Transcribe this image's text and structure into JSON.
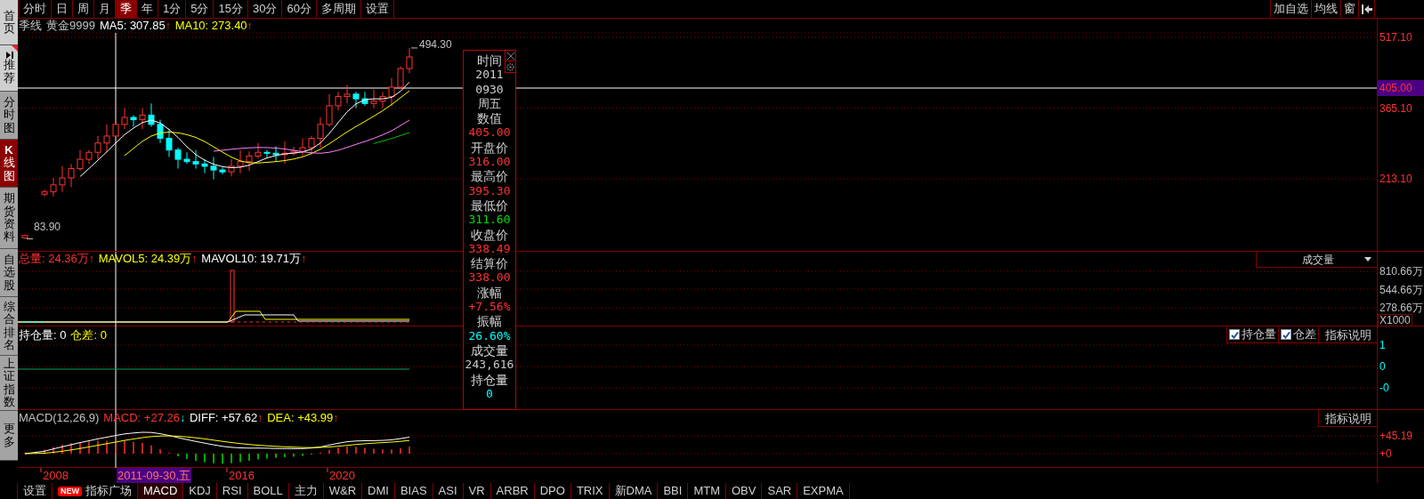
{
  "sidebar": {
    "items": [
      {
        "label": "首页",
        "kind": "light",
        "selected": false
      },
      {
        "label": "推荐",
        "kind": "recommend",
        "selected": false
      },
      {
        "label": "分时图",
        "kind": "page",
        "selected": false
      },
      {
        "label": "**K**线图",
        "kind": "page",
        "selected": true
      },
      {
        "label": "期货资料",
        "kind": "page",
        "selected": false
      },
      {
        "label": "自选股",
        "kind": "page",
        "selected": false
      },
      {
        "label": "综合排名",
        "kind": "page",
        "selected": false
      },
      {
        "label": "上证指数",
        "kind": "page",
        "selected": false
      },
      {
        "label": "更多",
        "kind": "page",
        "selected": false
      }
    ]
  },
  "toolbar": {
    "periods": [
      {
        "label": "分时",
        "selected": false
      },
      {
        "label": "日",
        "selected": false
      },
      {
        "label": "周",
        "selected": false
      },
      {
        "label": "月",
        "selected": false
      },
      {
        "label": "季",
        "selected": true
      },
      {
        "label": "年",
        "selected": false
      },
      {
        "label": "1分",
        "selected": false
      },
      {
        "label": "5分",
        "selected": false
      },
      {
        "label": "15分",
        "selected": false
      },
      {
        "label": "30分",
        "selected": false
      },
      {
        "label": "60分",
        "selected": false
      },
      {
        "label": "多周期",
        "selected": false
      },
      {
        "label": "设置",
        "selected": false
      }
    ],
    "actions": [
      "加自选",
      "均线",
      "窗"
    ]
  },
  "price_pane": {
    "legend": [
      {
        "text": "季线",
        "color": "#c0c0c0"
      },
      {
        "text": "黄金9999",
        "color": "#c0c0c0"
      },
      {
        "text": "MA5: 307.85",
        "color": "#ffffff",
        "arrow": "↑",
        "rising": true
      },
      {
        "text": "MA10: 273.40",
        "color": "#ffff00",
        "arrow": "↑",
        "rising": true
      }
    ],
    "high_marker": "494.30",
    "low_marker": "83.90",
    "axis_ticks": [
      "517.10",
      "365.10",
      "213.10"
    ],
    "crosshair_value": "405.00"
  },
  "volume_pane": {
    "legend": [
      {
        "text": "总量: 24.36万",
        "color": "#ff3232",
        "arrow": "↑",
        "rising": true
      },
      {
        "text": "MAVOL5: 24.39万",
        "color": "#ffff00",
        "arrow": "↑",
        "rising": true
      },
      {
        "text": "MAVOL10: 19.71万",
        "color": "#ffffff",
        "arrow": "↑",
        "rising": true
      }
    ],
    "dropdown": "成交量",
    "axis_ticks": [
      "810.66万",
      "544.66万",
      "278.66万"
    ],
    "unit": "X1000"
  },
  "position_pane": {
    "legend": [
      {
        "text": "持仓量: 0",
        "color": "#ffffff"
      },
      {
        "text": "仓差: 0",
        "color": "#ffff00"
      }
    ],
    "checkboxes": [
      {
        "label": "持仓量",
        "checked": true
      },
      {
        "label": "仓差",
        "checked": true
      }
    ],
    "button": "指标说明",
    "axis_ticks": [
      "1",
      "0",
      "-0"
    ]
  },
  "macd_pane": {
    "legend": [
      {
        "text": "MACD(12,26,9)",
        "color": "#c0c0c0"
      },
      {
        "text": "MACD: +27.26",
        "color": "#ff3232",
        "arrow": "↓",
        "rising": false
      },
      {
        "text": "DIFF: +57.62",
        "color": "#ffffff",
        "arrow": "↑",
        "rising": true
      },
      {
        "text": "DEA: +43.99",
        "color": "#ffff00",
        "arrow": "↑",
        "rising": true
      }
    ],
    "button": "指标说明",
    "axis_ticks": [
      "+45.19",
      "+0"
    ]
  },
  "date_axis": {
    "years": [
      "2008",
      "2016",
      "2020"
    ],
    "cursor": "2011-09-30,五"
  },
  "tooltip": {
    "time_label": "时间",
    "time_lines": [
      "2011",
      "0930",
      "周五"
    ],
    "fields": [
      {
        "label": "数值",
        "value": "405.00",
        "color": "#ff3232"
      },
      {
        "label": "开盘价",
        "value": "316.00",
        "color": "#ff3232"
      },
      {
        "label": "最高价",
        "value": "395.30",
        "color": "#ff3232"
      },
      {
        "label": "最低价",
        "value": "311.60",
        "color": "#00e000"
      },
      {
        "label": "收盘价",
        "value": "338.49",
        "color": "#ff3232"
      },
      {
        "label": "结算价",
        "value": "338.00",
        "color": "#ff3232"
      },
      {
        "label": "涨幅",
        "value": "+7.56%",
        "color": "#ff3232"
      },
      {
        "label": "振幅",
        "value": "26.60%",
        "color": "#00ffff"
      },
      {
        "label": "成交量",
        "value": "243,616",
        "color": "#c8c8c8"
      },
      {
        "label": "持仓量",
        "value": "0",
        "color": "#00ffff"
      }
    ]
  },
  "indicator_tabs": [
    {
      "label": "设置",
      "selected": false
    },
    {
      "label": "指标广场",
      "badge": "NEW",
      "selected": false
    },
    {
      "label": "MACD",
      "selected": true
    },
    {
      "label": "KDJ",
      "selected": false
    },
    {
      "label": "RSI",
      "selected": false
    },
    {
      "label": "BOLL",
      "selected": false
    },
    {
      "label": "主力",
      "selected": false
    },
    {
      "label": "W&R",
      "selected": false
    },
    {
      "label": "DMI",
      "selected": false
    },
    {
      "label": "BIAS",
      "selected": false
    },
    {
      "label": "ASI",
      "selected": false
    },
    {
      "label": "VR",
      "selected": false
    },
    {
      "label": "ARBR",
      "selected": false
    },
    {
      "label": "DPO",
      "selected": false
    },
    {
      "label": "TRIX",
      "selected": false
    },
    {
      "label": "新DMA",
      "selected": false
    },
    {
      "label": "BBI",
      "selected": false
    },
    {
      "label": "MTM",
      "selected": false
    },
    {
      "label": "OBV",
      "selected": false
    },
    {
      "label": "SAR",
      "selected": false
    },
    {
      "label": "EXPMA",
      "selected": false
    }
  ]
}
